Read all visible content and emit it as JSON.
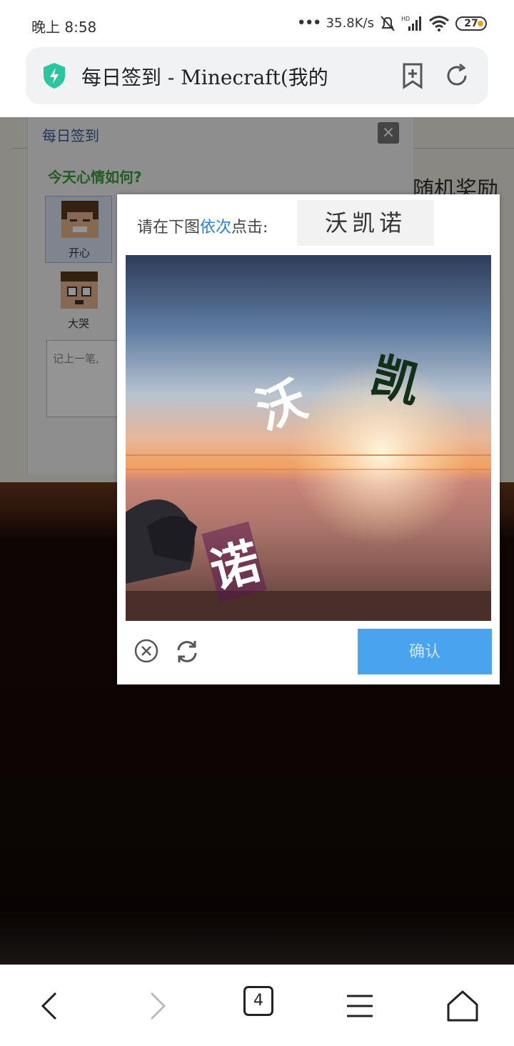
{
  "status_bar": {
    "time": "晚上 8:58",
    "net_speed": "35.8K/s",
    "battery": "27"
  },
  "address_bar": {
    "title": "每日签到 - Minecraft(我的"
  },
  "sign_dialog": {
    "title": "每日签到",
    "mood_question": "今天心情如何?",
    "moods": [
      {
        "label": "开心",
        "selected": true
      },
      {
        "label": "大哭",
        "selected": false
      }
    ],
    "note_placeholder": "记上一笔,",
    "reward_text": "随机奖励"
  },
  "captcha": {
    "prompt_prefix": "请在下图",
    "prompt_highlight": "依次",
    "prompt_suffix": "点击:",
    "target_chars": "沃凯诺",
    "image_chars": [
      "沃",
      "凯",
      "诺"
    ],
    "confirm_label": "确认"
  },
  "nav_bar": {
    "tab_count": "4"
  },
  "colors": {
    "accent": "#2e7dd7",
    "confirm_bg": "#4aa3ee",
    "shield": "#2cc5a0"
  }
}
